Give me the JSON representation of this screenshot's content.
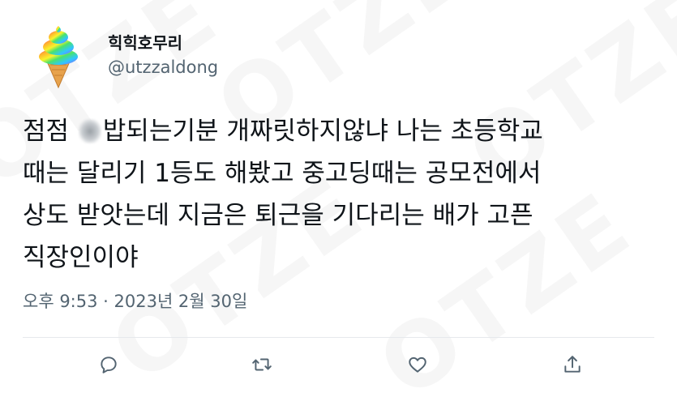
{
  "tweet": {
    "display_name": "힉힉호무리",
    "handle": "@utzzaldong",
    "text_line1_before": "점점 ",
    "text_line1_after": "밥되는기분 개짜릿하지않냐 나는 초등학교",
    "text_line2": "때는 달리기 1등도 해봤고 중고딩때는 공모전에서",
    "text_line3": "상도 받앗는데 지금은 퇴근을 기다리는 배가 고픈",
    "text_line4": "직장인이야",
    "timestamp": "오후 9:53 · 2023년 2월 30일"
  },
  "actions": [
    {
      "name": "reply",
      "icon": "speech-bubble-icon"
    },
    {
      "name": "retweet",
      "icon": "retweet-icon"
    },
    {
      "name": "like",
      "icon": "heart-icon"
    },
    {
      "name": "share",
      "icon": "share-icon"
    }
  ],
  "watermark": {
    "text": "OTZE",
    "color": "#000000"
  },
  "colors": {
    "text": "#0f1419",
    "secondary": "#536471",
    "divider": "#e6e9ec"
  }
}
